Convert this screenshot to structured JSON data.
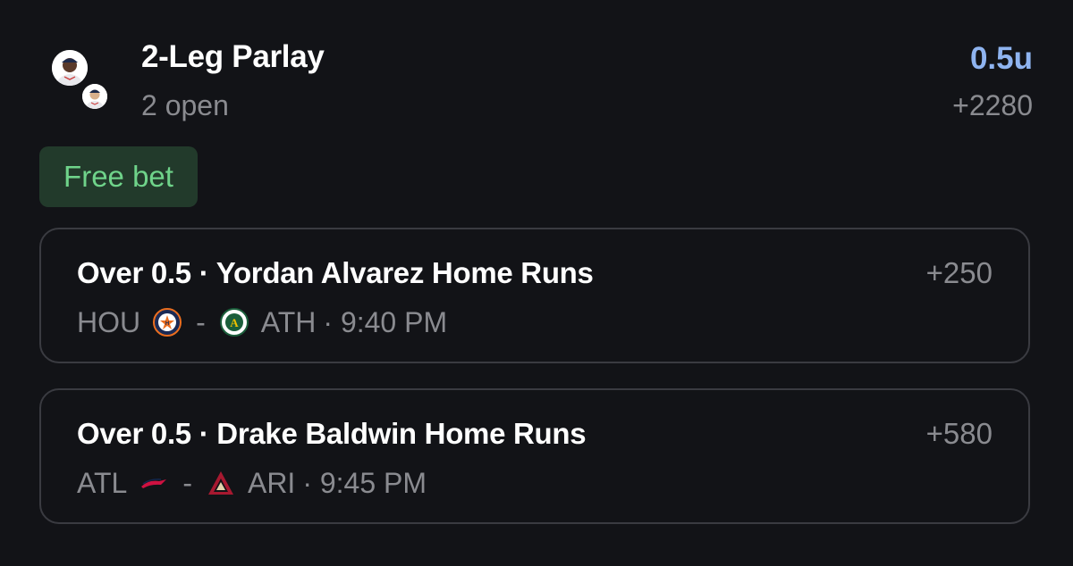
{
  "header": {
    "title": "2-Leg Parlay",
    "subtitle": "2 open",
    "stake": "0.5u",
    "total_odds": "+2280"
  },
  "badge": {
    "label": "Free bet"
  },
  "legs": [
    {
      "title": "Over 0.5 · Yordan Alvarez Home Runs",
      "odds": "+250",
      "home_team": "HOU",
      "home_logo": "astros-logo-icon",
      "dash": "-",
      "away_team": "ATH",
      "away_logo": "athletics-logo-icon",
      "time": "· 9:40 PM"
    },
    {
      "title": "Over 0.5 · Drake Baldwin Home Runs",
      "odds": "+580",
      "home_team": "ATL",
      "home_logo": "braves-logo-icon",
      "dash": "-",
      "away_team": "ARI",
      "away_logo": "diamondbacks-logo-icon",
      "time": "· 9:45 PM"
    }
  ],
  "colors": {
    "background": "#121317",
    "stake": "#8fb4f0",
    "badge_bg": "#223a2b",
    "badge_text": "#6fd38a",
    "muted": "#8a8b90",
    "border": "#3a3b41"
  }
}
